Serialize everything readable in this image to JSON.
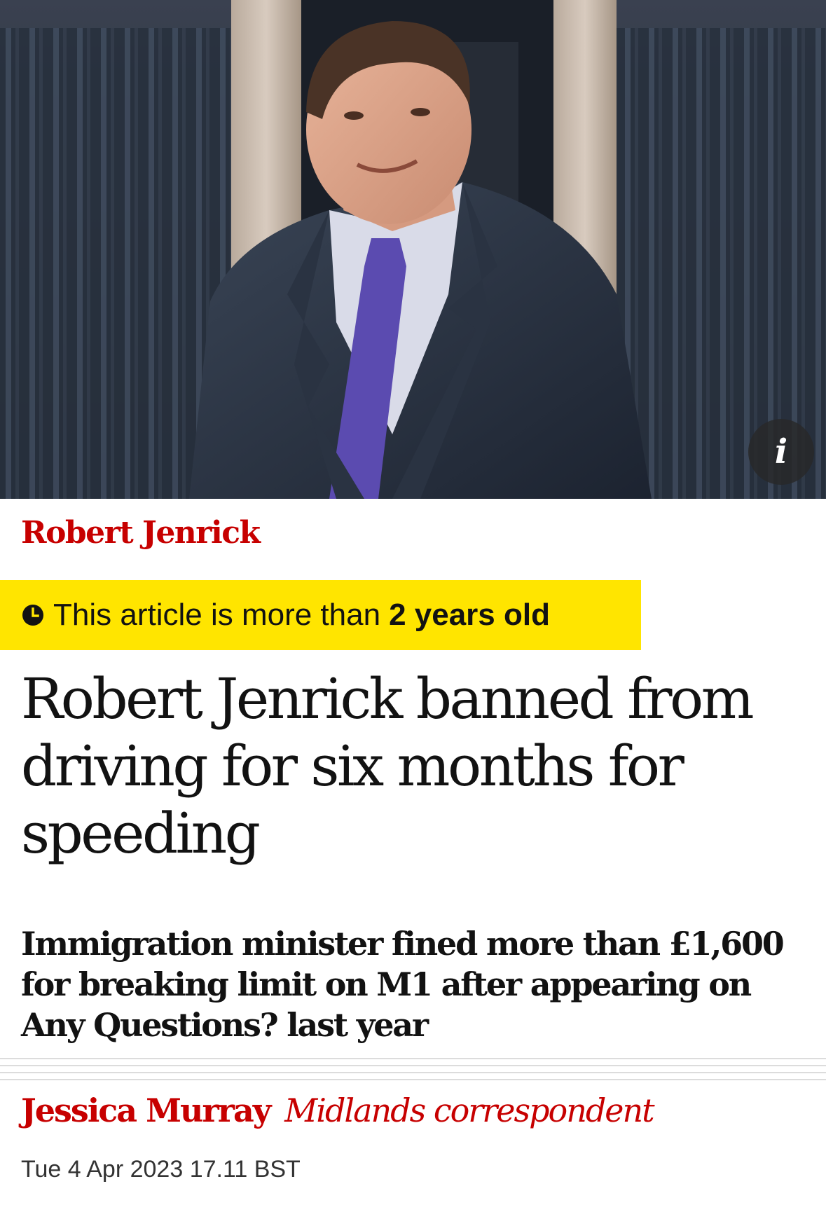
{
  "hero": {
    "info_icon": "info-icon",
    "info_glyph": "i"
  },
  "kicker": {
    "label": "Robert Jenrick"
  },
  "age_warning": {
    "icon": "clock-icon",
    "text": "This article is more than",
    "emphasis": "2 years old"
  },
  "headline": "Robert Jenrick banned from driving for six months for speeding",
  "standfirst": "Immigration minister fined more than £1,600 for breaking limit on M1 after appearing on Any Questions? last year",
  "byline": {
    "author": "Jessica Murray",
    "role": "Midlands correspondent"
  },
  "dateline": "Tue 4 Apr 2023 17.11 BST",
  "colors": {
    "kicker_red": "#c70000",
    "banner_yellow": "#ffe500",
    "text": "#121212"
  }
}
